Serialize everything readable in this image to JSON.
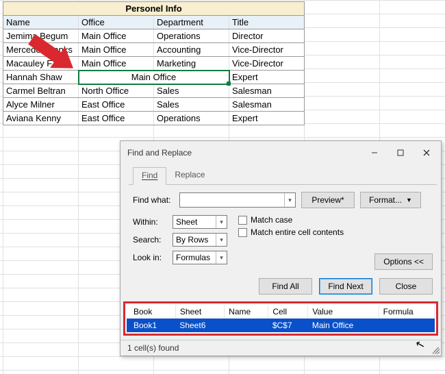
{
  "sheet": {
    "title": "Personel Info",
    "columns": [
      "Name",
      "Office",
      "Department",
      "Title"
    ],
    "rows": [
      {
        "name": "Jemima Begum",
        "office": "Main Office",
        "dept": "Operations",
        "title": "Director"
      },
      {
        "name": "Mercedes Banks",
        "office": "Main Office",
        "dept": "Accounting",
        "title": "Vice-Director"
      },
      {
        "name": "Macauley F",
        "office": "Main Office",
        "dept": "Marketing",
        "title": "Vice-Director"
      },
      {
        "name": "Hannah Shaw",
        "office": "Main Office",
        "dept": "",
        "title": "Expert"
      },
      {
        "name": "Carmel Beltran",
        "office": "North Office",
        "dept": "Sales",
        "title": "Salesman"
      },
      {
        "name": "Alyce Milner",
        "office": "East Office",
        "dept": "Sales",
        "title": "Salesman"
      },
      {
        "name": "Aviana Kenny",
        "office": "East Office",
        "dept": "Operations",
        "title": "Expert"
      }
    ],
    "merged_row_index": 3
  },
  "dialog": {
    "title": "Find and Replace",
    "tabs": {
      "find": "Find",
      "replace": "Replace"
    },
    "find_what_label": "Find what:",
    "preview_button": "Preview*",
    "format_button": "Format...",
    "within_label": "Within:",
    "within_value": "Sheet",
    "search_label": "Search:",
    "search_value": "By Rows",
    "lookin_label": "Look in:",
    "lookin_value": "Formulas",
    "match_case": "Match case",
    "match_entire": "Match entire cell contents",
    "options_button": "Options <<",
    "find_all": "Find All",
    "find_next": "Find Next",
    "close": "Close",
    "results": {
      "headers": [
        "Book",
        "Sheet",
        "Name",
        "Cell",
        "Value",
        "Formula"
      ],
      "rows": [
        {
          "book": "Book1",
          "sheet": "Sheet6",
          "name": "",
          "cell": "$C$7",
          "value": "Main Office",
          "formula": ""
        }
      ]
    },
    "status": "1 cell(s) found"
  }
}
